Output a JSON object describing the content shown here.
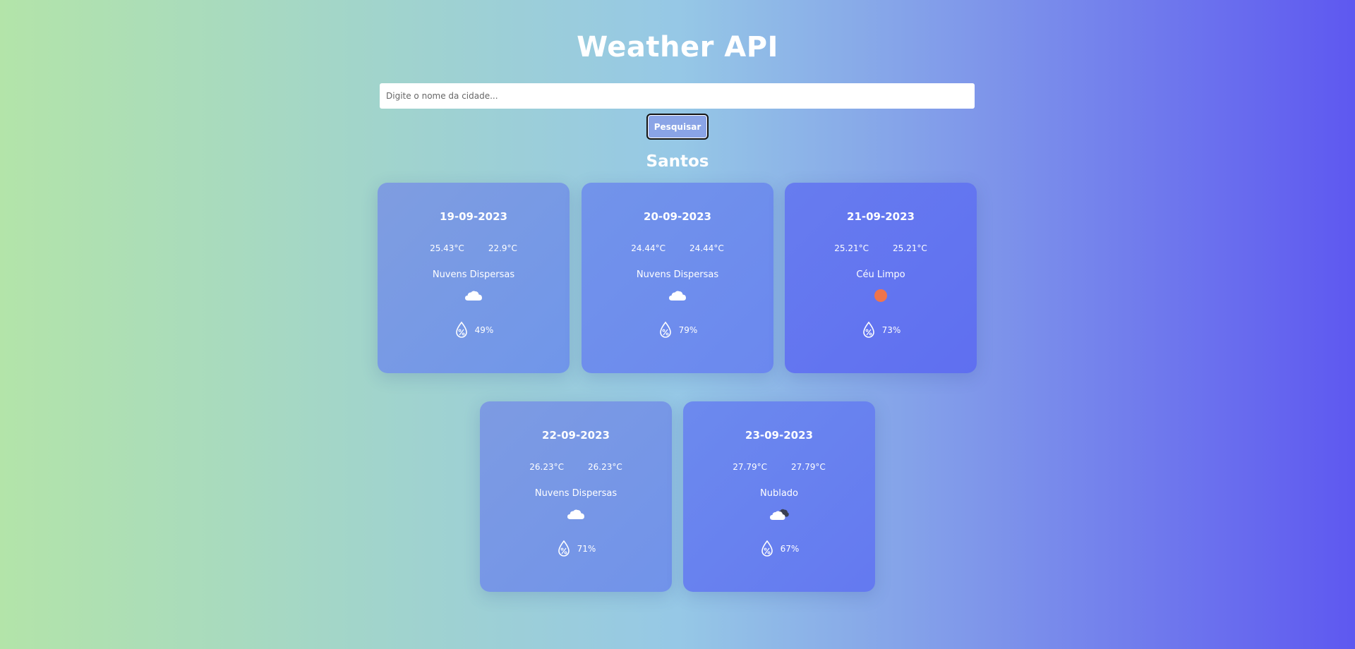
{
  "header": {
    "title": "Weather API"
  },
  "search": {
    "placeholder": "Digite o nome da cidade...",
    "value": "",
    "button_label": "Pesquisar"
  },
  "city": "Santos",
  "forecast": [
    {
      "date": "19-09-2023",
      "temp_max": "25.43°C",
      "temp_min": "22.9°C",
      "description": "Nuvens Dispersas",
      "icon": "cloud-icon",
      "humidity": "49%"
    },
    {
      "date": "20-09-2023",
      "temp_max": "24.44°C",
      "temp_min": "24.44°C",
      "description": "Nuvens Dispersas",
      "icon": "cloud-icon",
      "humidity": "79%"
    },
    {
      "date": "21-09-2023",
      "temp_max": "25.21°C",
      "temp_min": "25.21°C",
      "description": "Céu Limpo",
      "icon": "sun-icon",
      "humidity": "73%"
    },
    {
      "date": "22-09-2023",
      "temp_max": "26.23°C",
      "temp_min": "26.23°C",
      "description": "Nuvens Dispersas",
      "icon": "cloud-icon",
      "humidity": "71%"
    },
    {
      "date": "23-09-2023",
      "temp_max": "27.79°C",
      "temp_min": "27.79°C",
      "description": "Nublado",
      "icon": "broken-clouds-icon",
      "humidity": "67%"
    }
  ],
  "colors": {
    "sun": "#f0744c",
    "cloud": "#ffffff",
    "dark_cloud": "#3a3f52"
  }
}
